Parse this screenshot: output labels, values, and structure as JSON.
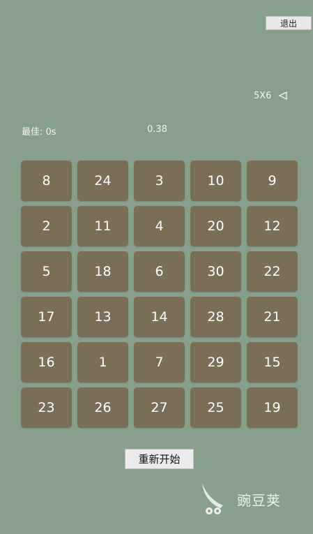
{
  "header": {
    "exit_label": "退出",
    "grid_size": "5X6",
    "grid_size_icon": "triangle-left-outline-icon"
  },
  "stats": {
    "best": "最佳: 0s",
    "timer": "0.38"
  },
  "board": {
    "columns": 5,
    "rows": 6,
    "tiles": [
      [
        "8",
        "24",
        "3",
        "10",
        "9"
      ],
      [
        "2",
        "11",
        "4",
        "20",
        "12"
      ],
      [
        "5",
        "18",
        "6",
        "30",
        "22"
      ],
      [
        "17",
        "13",
        "14",
        "28",
        "21"
      ],
      [
        "16",
        "1",
        "7",
        "29",
        "15"
      ],
      [
        "23",
        "26",
        "27",
        "25",
        "19"
      ]
    ]
  },
  "footer": {
    "restart_label": "重新开始"
  },
  "watermark": {
    "logo_icon": "wandoujia-logo-icon",
    "text": "豌豆荚"
  },
  "colors": {
    "background": "#86a08c",
    "tile": "#7a6e57",
    "tile_text": "#ffffff"
  }
}
